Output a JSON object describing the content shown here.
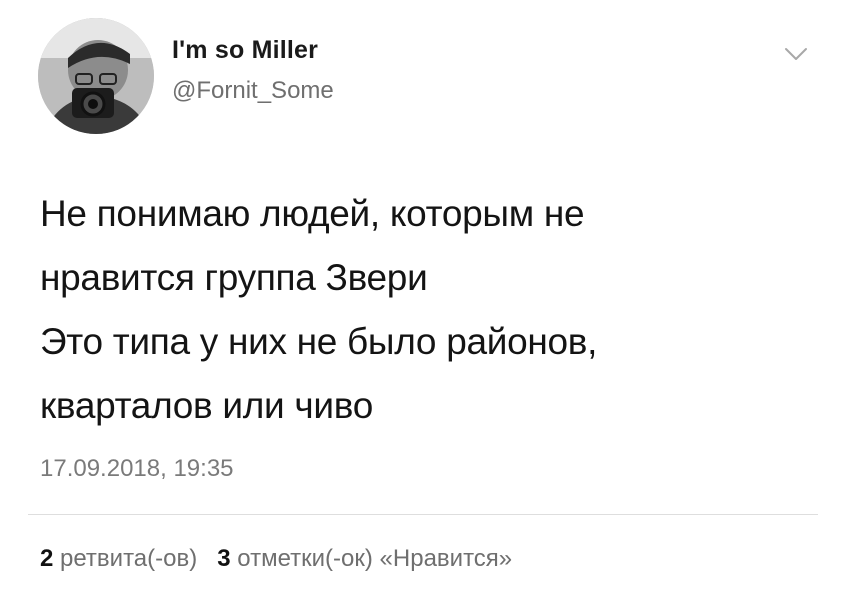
{
  "author": {
    "display_name": "I'm so Miller",
    "handle": "@Fornit_Some",
    "avatar_icon": "user-photo-avatar"
  },
  "menu_icon": "chevron-down-icon",
  "tweet": {
    "lines": [
      "Не понимаю людей, которым не",
      "нравится группа Звери",
      "Это типа у них не было районов,",
      "кварталов или чиво"
    ],
    "timestamp": "17.09.2018, 19:35"
  },
  "stats": {
    "retweets": {
      "count": "2",
      "label": "ретвита(-ов)"
    },
    "likes": {
      "count": "3",
      "label": "отметки(-ок) «Нравится»"
    }
  },
  "colors": {
    "text": "#141414",
    "secondary": "#6f6f6f",
    "divider": "#dedede",
    "background": "#ffffff"
  }
}
